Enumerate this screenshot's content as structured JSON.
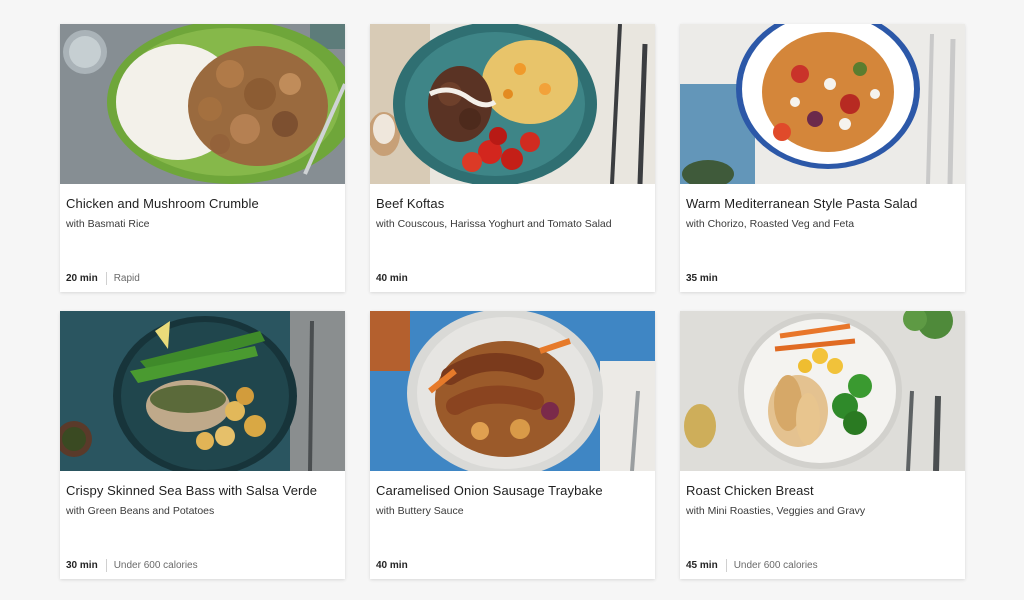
{
  "recipes": [
    {
      "title": "Chicken and Mushroom Crumble",
      "subtitle": "with Basmati Rice",
      "time": "20 min",
      "tag": "Rapid",
      "image_icon": "chicken-rice-plate-image"
    },
    {
      "title": "Beef Koftas",
      "subtitle": "with Couscous, Harissa Yoghurt and Tomato Salad",
      "time": "40 min",
      "tag": "",
      "image_icon": "beef-kofta-plate-image"
    },
    {
      "title": "Warm Mediterranean Style Pasta Salad",
      "subtitle": "with Chorizo, Roasted Veg and Feta",
      "time": "35 min",
      "tag": "",
      "image_icon": "pasta-salad-plate-image"
    },
    {
      "title": "Crispy Skinned Sea Bass with Salsa Verde",
      "subtitle": "with Green Beans and Potatoes",
      "time": "30 min",
      "tag": "Under 600 calories",
      "image_icon": "sea-bass-plate-image"
    },
    {
      "title": "Caramelised Onion Sausage Traybake",
      "subtitle": "with Buttery Sauce",
      "time": "40 min",
      "tag": "",
      "image_icon": "sausage-traybake-plate-image"
    },
    {
      "title": "Roast Chicken Breast",
      "subtitle": "with Mini Roasties, Veggies and Gravy",
      "time": "45 min",
      "tag": "Under 600 calories",
      "image_icon": "roast-chicken-plate-image"
    }
  ]
}
